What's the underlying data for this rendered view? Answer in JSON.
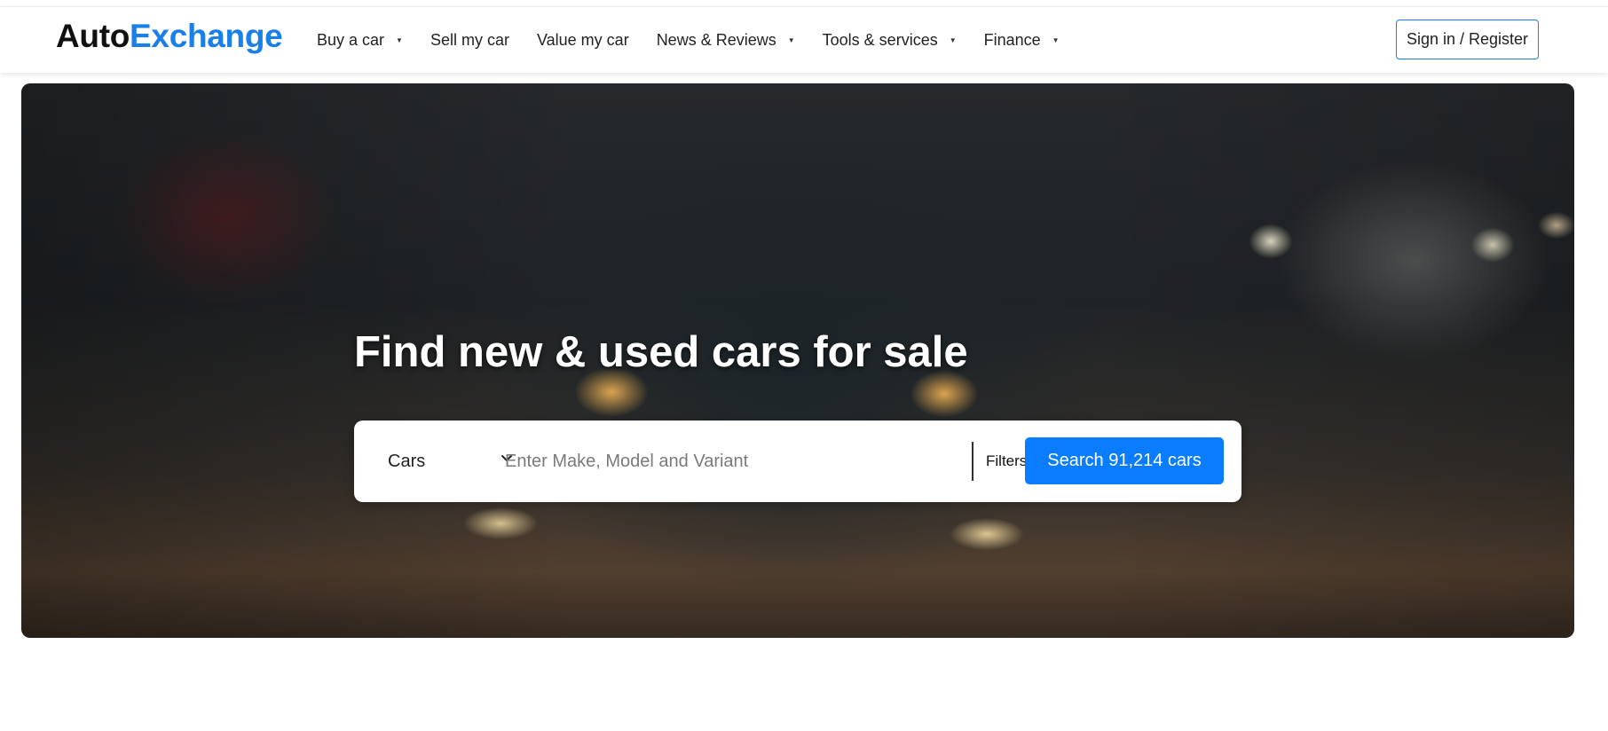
{
  "brand": {
    "part1": "Auto",
    "part2": "Exchange"
  },
  "nav": {
    "items": [
      {
        "label": "Buy a car",
        "has_dropdown": true
      },
      {
        "label": "Sell my car",
        "has_dropdown": false
      },
      {
        "label": "Value my car",
        "has_dropdown": false
      },
      {
        "label": "News & Reviews",
        "has_dropdown": true
      },
      {
        "label": "Tools & services",
        "has_dropdown": true
      },
      {
        "label": "Finance",
        "has_dropdown": true
      }
    ],
    "caret_icon": "caret-down-icon"
  },
  "auth": {
    "label": "Sign in / Register"
  },
  "hero": {
    "title": "Find new & used cars for sale"
  },
  "search": {
    "category": "Cars",
    "chevron_icon": "chevron-down-icon",
    "placeholder": "Enter Make, Model and Variant",
    "value": "",
    "filters_label": "Filters",
    "button_label": "Search 91,214 cars"
  },
  "colors": {
    "brand_blue": "#1a7fe8",
    "button_blue": "#0a7cff"
  }
}
